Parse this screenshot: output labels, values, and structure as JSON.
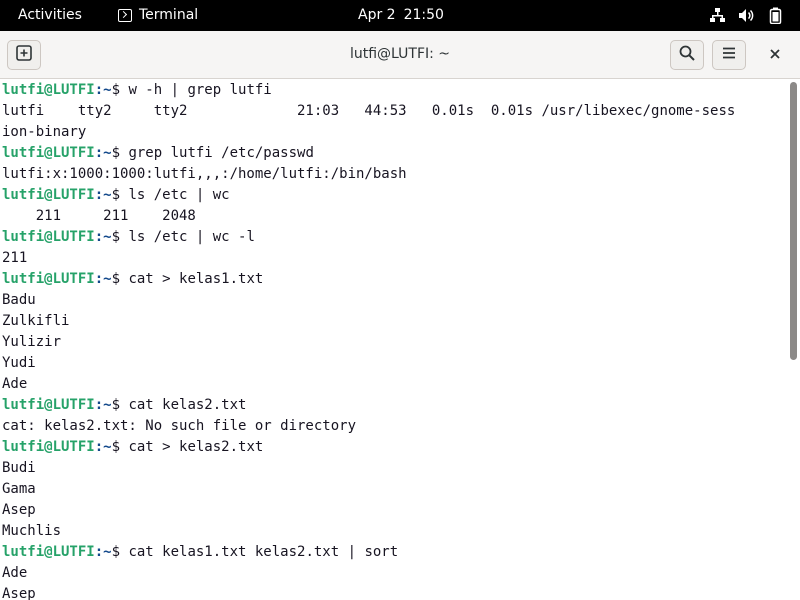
{
  "topbar": {
    "activities": "Activities",
    "app_name": "Terminal",
    "date": "Apr 2",
    "time": "21:50",
    "icons": [
      "network-icon",
      "volume-icon",
      "battery-icon"
    ]
  },
  "window": {
    "title": "lutfi@LUTFI: ~",
    "buttons": [
      "new-tab-icon",
      "search-icon",
      "hamburger-menu-icon",
      "close-icon"
    ]
  },
  "terminal": {
    "prompt_user": "lutfi@LUTFI",
    "prompt_path": ":~",
    "prompt_symbol": "$ ",
    "colors": {
      "user": "#26a269",
      "path": "#12488b",
      "text": "#171421"
    },
    "lines": [
      {
        "type": "cmd",
        "text": "w -h | grep lutfi"
      },
      {
        "type": "out",
        "text": "lutfi    tty2     tty2             21:03   44:53   0.01s  0.01s /usr/libexec/gnome-sess"
      },
      {
        "type": "out",
        "text": "ion-binary"
      },
      {
        "type": "cmd",
        "text": "grep lutfi /etc/passwd"
      },
      {
        "type": "out",
        "text": "lutfi:x:1000:1000:lutfi,,,:/home/lutfi:/bin/bash"
      },
      {
        "type": "cmd",
        "text": "ls /etc | wc"
      },
      {
        "type": "out",
        "text": "    211     211    2048"
      },
      {
        "type": "cmd",
        "text": "ls /etc | wc -l"
      },
      {
        "type": "out",
        "text": "211"
      },
      {
        "type": "cmd",
        "text": "cat > kelas1.txt"
      },
      {
        "type": "out",
        "text": "Badu"
      },
      {
        "type": "out",
        "text": "Zulkifli"
      },
      {
        "type": "out",
        "text": "Yulizir"
      },
      {
        "type": "out",
        "text": "Yudi"
      },
      {
        "type": "out",
        "text": "Ade"
      },
      {
        "type": "cmd",
        "text": "cat kelas2.txt"
      },
      {
        "type": "out",
        "text": "cat: kelas2.txt: No such file or directory"
      },
      {
        "type": "cmd",
        "text": "cat > kelas2.txt"
      },
      {
        "type": "out",
        "text": "Budi"
      },
      {
        "type": "out",
        "text": "Gama"
      },
      {
        "type": "out",
        "text": "Asep"
      },
      {
        "type": "out",
        "text": "Muchlis"
      },
      {
        "type": "cmd",
        "text": "cat kelas1.txt kelas2.txt | sort"
      },
      {
        "type": "out",
        "text": "Ade"
      },
      {
        "type": "out",
        "text": "Asep"
      }
    ]
  }
}
